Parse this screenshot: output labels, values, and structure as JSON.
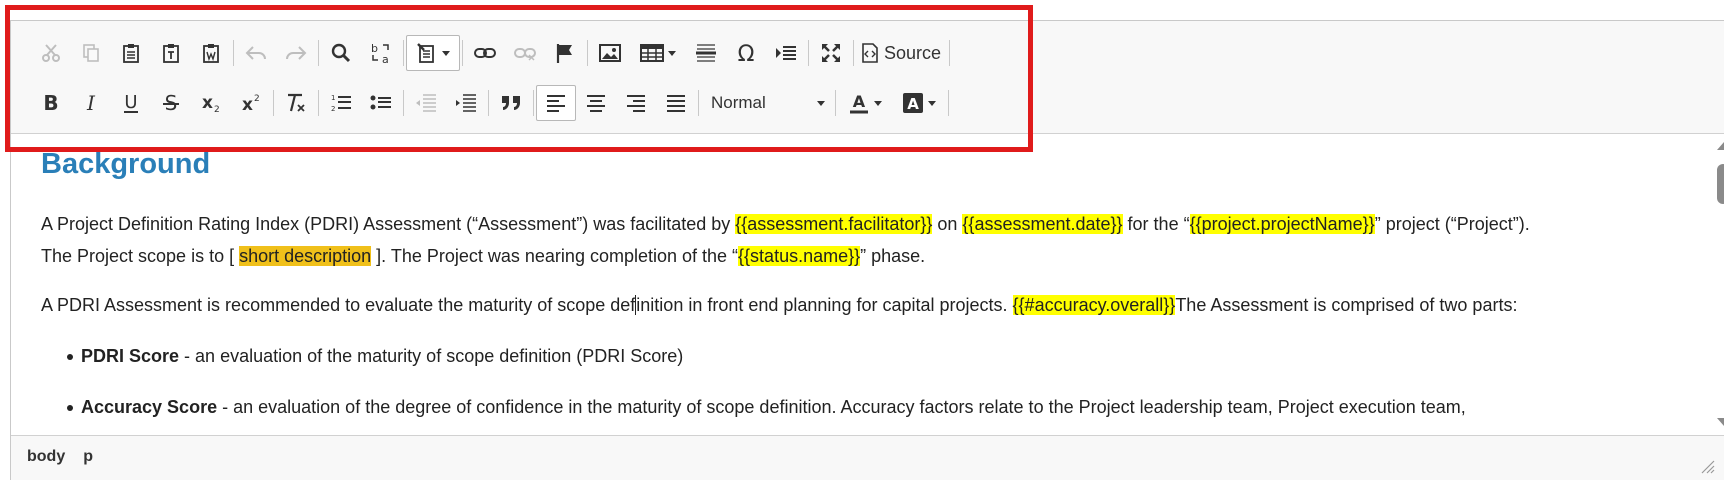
{
  "toolbar": {
    "source_label": "Source",
    "format_value": "Normal"
  },
  "content": {
    "heading": "Background",
    "p1": {
      "t1": "A Project Definition Rating Index (PDRI) Assessment (“Assessment”) was facilitated by ",
      "tag1": "{{assessment.facilitator}}",
      "t2": " on ",
      "tag2": "{{assessment.date}}",
      "t3": " for the “",
      "tag3": "{{project.projectName}}",
      "t4": "” project (“Project”).",
      "l2a": "The Project scope is to [ ",
      "tag4": "short description",
      "l2b": " ].  The Project was nearing completion of the “",
      "tag5": "{{status.name}}",
      "l2c": "” phase."
    },
    "p2": {
      "t1a": "A PDRI Assessment is recommended to evaluate the maturity of scope def",
      "t1b": "inition in front end planning for capital projects. ",
      "tag1": "{{#accuracy.overall}}",
      "t2": "The Assessment is comprised of two parts:"
    },
    "bullets": [
      {
        "bold": "PDRI Score",
        "text": " - an evaluation of the maturity of scope definition (PDRI Score)"
      },
      {
        "bold": "Accuracy Score",
        "text": " - an evaluation of the degree of confidence in the maturity of scope definition. Accuracy factors relate to the Project leadership team, Project execution team,"
      }
    ]
  },
  "statusbar": {
    "path": [
      "body",
      "p"
    ]
  },
  "colors": {
    "heading": "#2a7fb8",
    "highlight_yellow": "#ffff00",
    "highlight_orange": "#f0c01a",
    "annotation_red": "#e01b1b"
  }
}
